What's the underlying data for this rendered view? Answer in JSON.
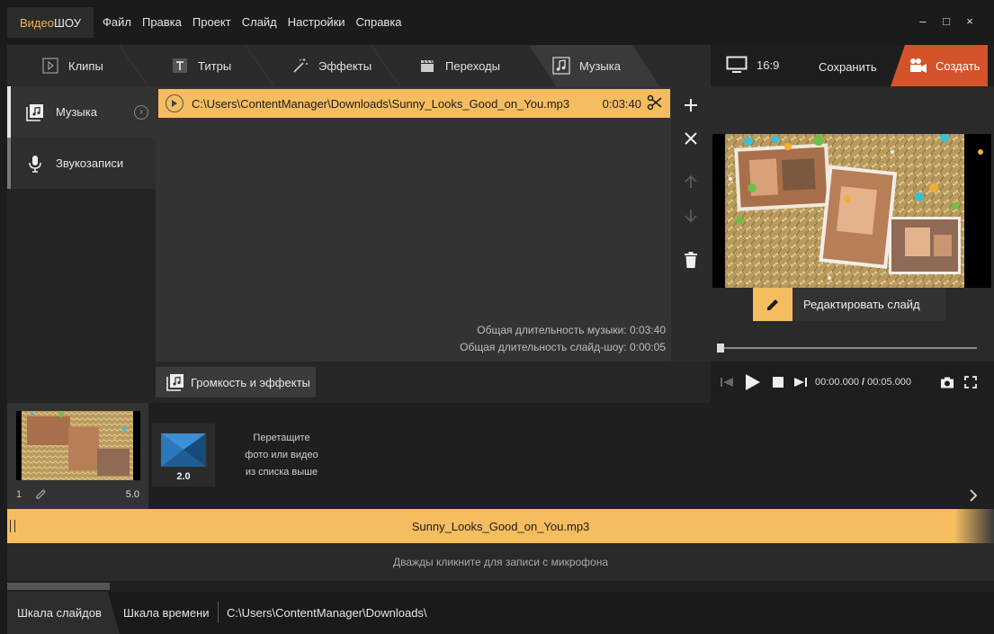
{
  "app": {
    "logo_part1": "Видео",
    "logo_part2": "ШОУ"
  },
  "menu": [
    "Файл",
    "Правка",
    "Проект",
    "Слайд",
    "Настройки",
    "Справка"
  ],
  "window_controls": {
    "minimize": "–",
    "maximize": "□",
    "close": "×"
  },
  "tabs": [
    {
      "label": "Клипы",
      "icon": "play-icon"
    },
    {
      "label": "Титры",
      "icon": "text-icon"
    },
    {
      "label": "Эффекты",
      "icon": "magic-wand-icon"
    },
    {
      "label": "Переходы",
      "icon": "clapper-icon"
    },
    {
      "label": "Музыка",
      "icon": "music-note-icon",
      "active": true
    }
  ],
  "right_top": {
    "ratio": "16:9",
    "save": "Сохранить",
    "create": "Создать"
  },
  "sidebar": [
    {
      "label": "Музыка",
      "active": true
    },
    {
      "label": "Звукозаписи",
      "active": false
    }
  ],
  "music": {
    "track_path": "C:\\Users\\ContentManager\\Downloads\\Sunny_Looks_Good_on_You.mp3",
    "track_duration": "0:03:40",
    "total_music": "Общая длительность музыки: 0:03:40",
    "total_show": "Общая длительность слайд-шоу: 0:00:05",
    "volume_button": "Громкость и эффекты"
  },
  "preview": {
    "edit_slide": "Редактировать слайд",
    "time_current": "00:00.000",
    "time_sep": " / ",
    "time_total": "00:05.000",
    "progress": 0
  },
  "slides": {
    "slide_number": "1",
    "slide_duration": "5.0",
    "transition_duration": "2.0",
    "drop_hint_line1": "Перетащите",
    "drop_hint_line2": "фото или видео",
    "drop_hint_line3": "из списка выше"
  },
  "audio_track": {
    "name": "Sunny_Looks_Good_on_You.mp3"
  },
  "mic_hint": "Дважды кликните для записи с микрофона",
  "bottom": {
    "tab_slides": "Шкала слайдов",
    "tab_timeline": "Шкала времени",
    "path": "C:\\Users\\ContentManager\\Downloads\\"
  },
  "colors": {
    "accent": "#f5bd60",
    "create_button": "#d4532a",
    "background": "#1c1c1c"
  }
}
